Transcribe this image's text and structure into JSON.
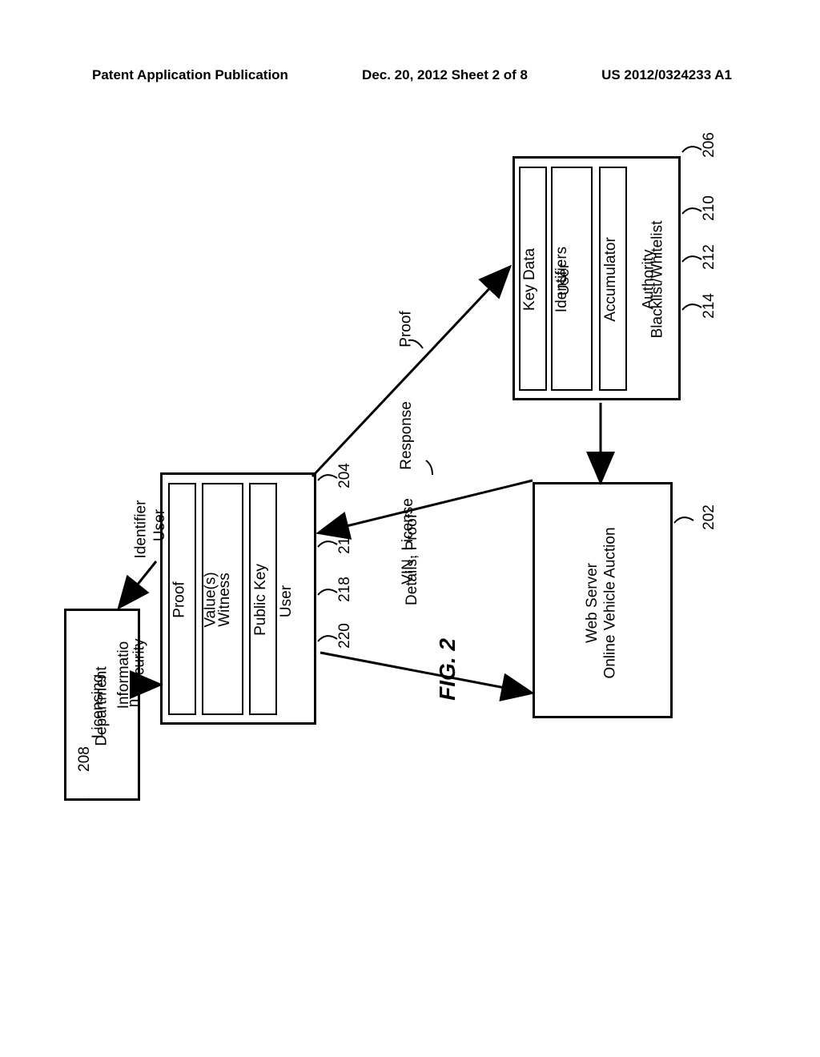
{
  "header": {
    "left": "Patent Application Publication",
    "center": "Dec. 20, 2012  Sheet 2 of 8",
    "right": "US 2012/0324233 A1"
  },
  "boxes": {
    "authority": {
      "title1": "Blacklist/Whitelist",
      "title2": "Authority",
      "ref": "206",
      "items": {
        "accumulator": {
          "label": "Accumulator",
          "ref": "210"
        },
        "identifiers": {
          "label1": "User",
          "label2": "Identifiers",
          "ref": "212"
        },
        "keydata": {
          "label": "Key Data",
          "ref": "214"
        }
      }
    },
    "server": {
      "title1": "Online Vehicle Auction",
      "title2": "Web Server",
      "ref": "202"
    },
    "user": {
      "title": "User",
      "ref": "204",
      "items": {
        "pubkey": {
          "label": "Public Key",
          "ref": "216"
        },
        "witness": {
          "label1": "Witness",
          "label2": "Value(s)",
          "ref": "218"
        },
        "proof": {
          "label": "Proof",
          "ref": "220"
        }
      }
    },
    "licensing": {
      "title1": "Licensing",
      "title2": "Department",
      "ref": "208"
    }
  },
  "edges": {
    "proof": "Proof",
    "response": "Response",
    "vin1": "VIN, License",
    "vin2": "Details, Proof",
    "userid1": "User",
    "userid2": "Identifier",
    "sec1": "Security",
    "sec2": "Informatio",
    "sec3": "n"
  },
  "figure": "FIG. 2"
}
